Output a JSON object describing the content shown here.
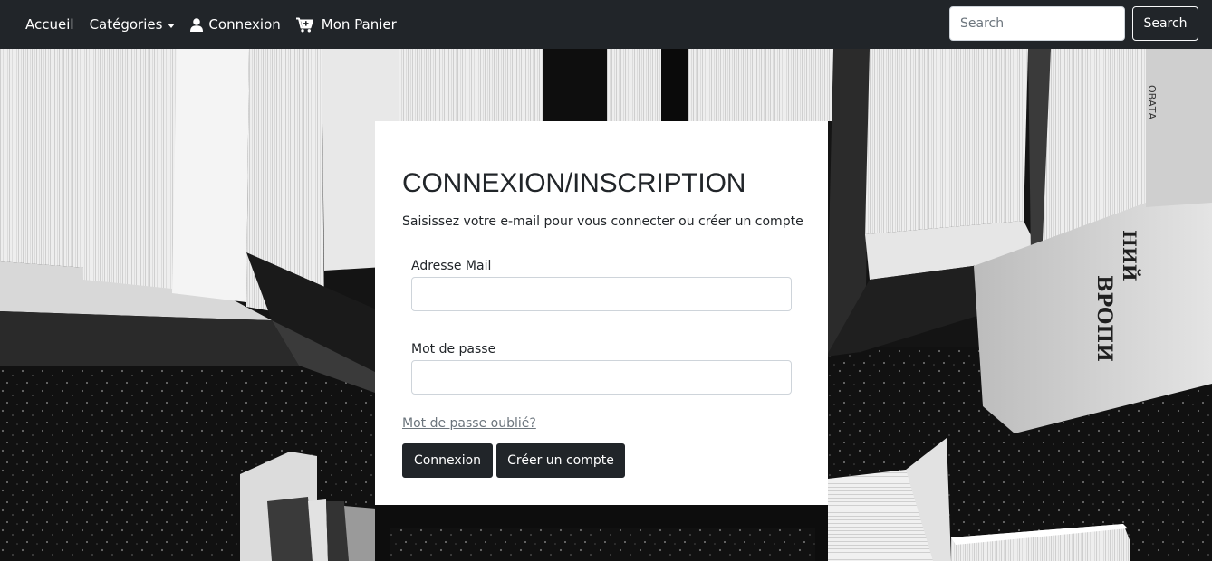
{
  "navbar": {
    "links": {
      "home": "Accueil",
      "categories": "Catégories",
      "login": "Connexion",
      "cart": "Mon Panier"
    },
    "icons": {
      "categories": "caret-down-icon",
      "login": "user-icon",
      "cart": "cart-plus-icon"
    },
    "search": {
      "placeholder": "Search",
      "value": "",
      "button_label": "Search"
    }
  },
  "login_card": {
    "title": "CONNEXION/INSCRIPTION",
    "subtitle": "Saisissez votre e-mail pour vous connecter ou créer un compte",
    "email": {
      "label": "Adresse Mail",
      "value": ""
    },
    "password": {
      "label": "Mot de passe",
      "value": ""
    },
    "forgot_password": "Mot de passe oublié?",
    "login_button": "Connexion",
    "signup_button": "Créer un compte"
  },
  "colors": {
    "navbar_bg": "#212529",
    "button_dark": "#212529",
    "card_bg": "#ffffff",
    "link_muted": "#6c757d"
  }
}
